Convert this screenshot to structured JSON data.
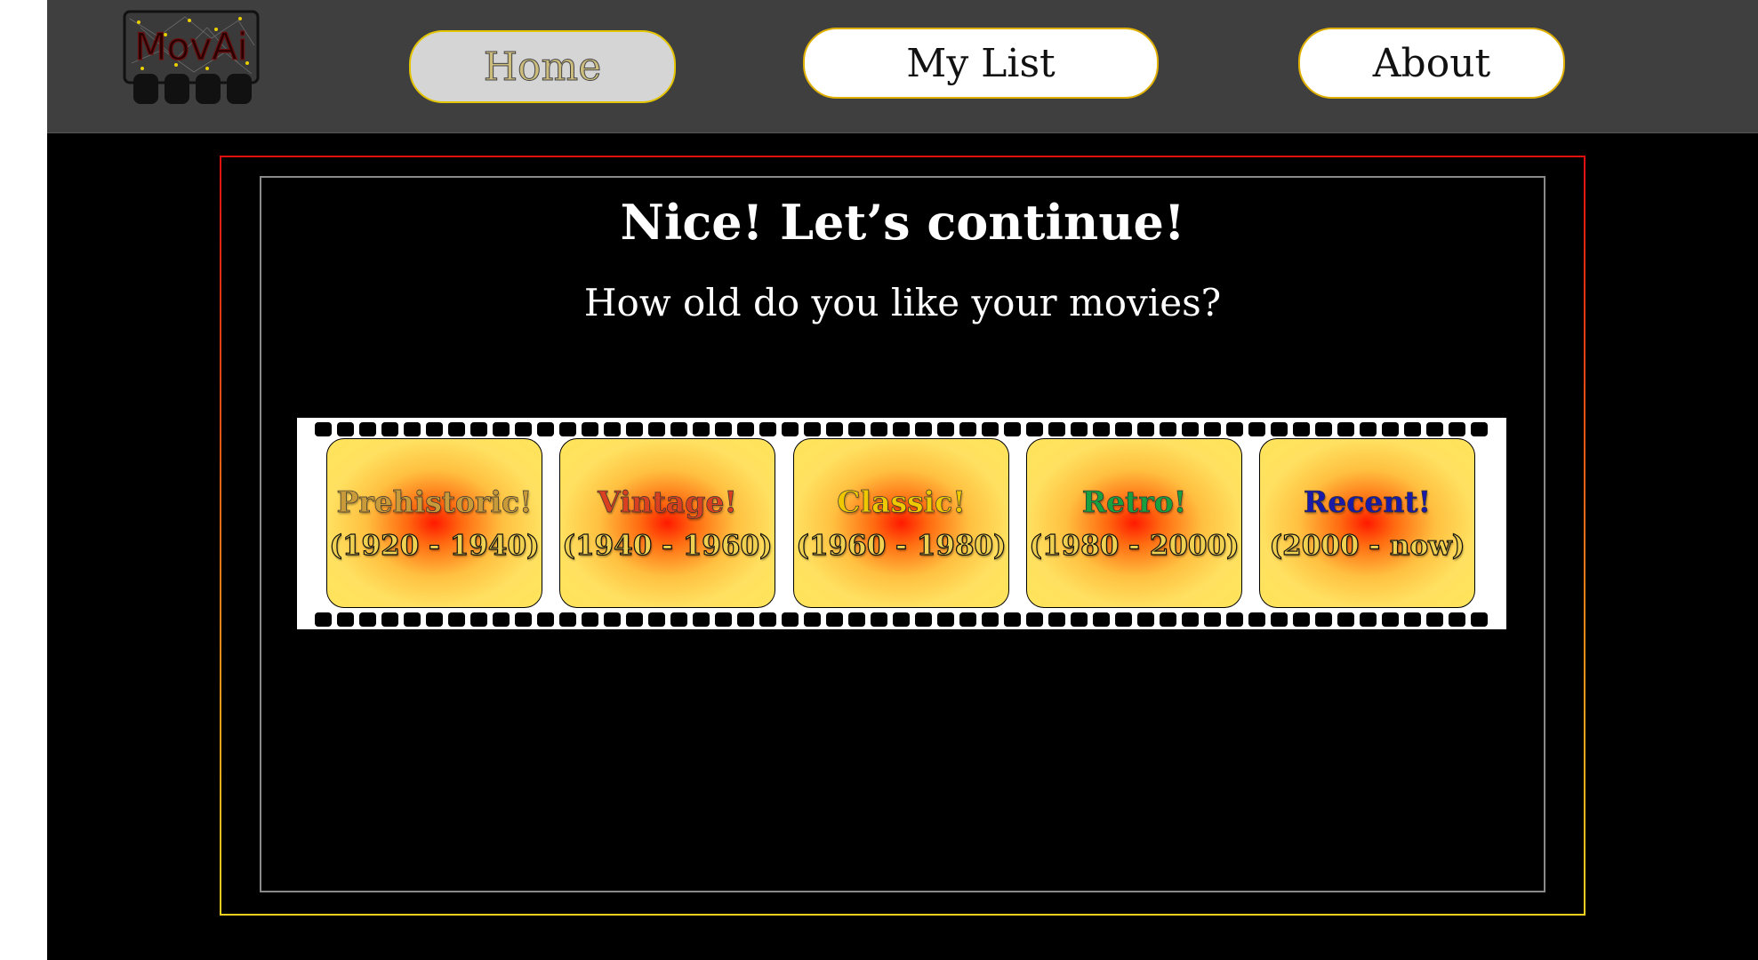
{
  "header": {
    "logo_text": "MovAi",
    "nav": {
      "home": "Home",
      "my_list": "My List",
      "about": "About"
    }
  },
  "main": {
    "heading": "Nice! Let’s continue!",
    "subheading": "How old do you like your movies?",
    "eras": [
      {
        "name": "Prehistoric!",
        "range": "(1920 - 1940)",
        "color": "#d8a020"
      },
      {
        "name": "Vintage!",
        "range": "(1940 - 1960)",
        "color": "#e03a1a"
      },
      {
        "name": "Classic!",
        "range": "(1960 - 1980)",
        "color": "#f0c800"
      },
      {
        "name": "Retro!",
        "range": "(1980 - 2000)",
        "color": "#18a040"
      },
      {
        "name": "Recent!",
        "range": "(2000 - now)",
        "color": "#1a1aa8"
      }
    ]
  },
  "colors": {
    "header_bg": "#3f3f3f",
    "page_bg": "#000000",
    "frame_gradient_top": "#e01010",
    "frame_gradient_bottom": "#f3d020"
  }
}
